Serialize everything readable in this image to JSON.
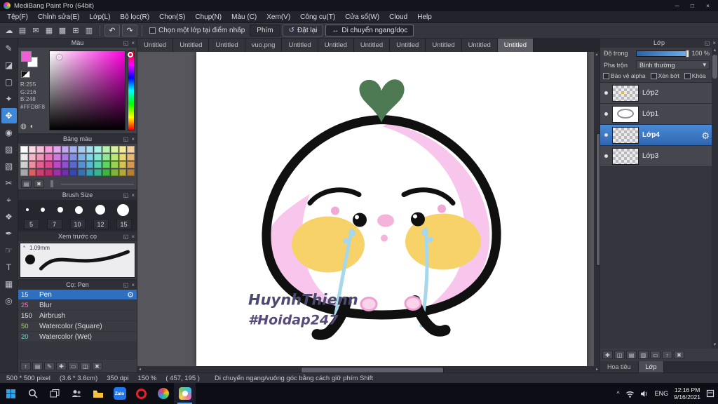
{
  "colors": {
    "accent": "#3f87d8",
    "selection": "#2f6fbf",
    "current_color": "#FFD8F8"
  },
  "window": {
    "title": "MediBang Paint Pro (64bit)",
    "minimize": "─",
    "maximize": "□",
    "close": "×"
  },
  "menubar": {
    "items": [
      "Tệp(F)",
      "Chỉnh sửa(E)",
      "Lớp(L)",
      "Bộ lọc(R)",
      "Chọn(S)",
      "Chụp(N)",
      "Màu (C)",
      "Xem(V)",
      "Công cụ(T)",
      "Cửa sổ(W)",
      "Cloud",
      "Help"
    ]
  },
  "toolbar": {
    "icons": [
      {
        "name": "cloud-icon",
        "glyph": "☁"
      },
      {
        "name": "save-icon",
        "glyph": "▤"
      },
      {
        "name": "mail-icon",
        "glyph": "✉"
      },
      {
        "name": "page-icon",
        "glyph": "▦"
      },
      {
        "name": "grid-icon",
        "glyph": "▩"
      },
      {
        "name": "snap-grid-icon",
        "glyph": "⊞"
      },
      {
        "name": "material-icon",
        "glyph": "▥"
      }
    ],
    "undo": "↶",
    "redo": "↷",
    "checkbox_label": "Chọn một lớp tại điểm nhấp",
    "key_label": "Phím",
    "reset_label": "Đặt lại",
    "move_label": "Di chuyển ngang/dọc"
  },
  "toolstrip": {
    "tools": [
      {
        "name": "pen-tool",
        "glyph": "✎",
        "selected": false
      },
      {
        "name": "eraser-tool",
        "glyph": "◪",
        "selected": false
      },
      {
        "name": "marquee-tool",
        "glyph": "▢",
        "selected": false
      },
      {
        "name": "magic-wand-tool",
        "glyph": "✦",
        "selected": false
      },
      {
        "name": "move-tool",
        "glyph": "✥",
        "selected": true
      },
      {
        "name": "bucket-tool",
        "glyph": "◉",
        "selected": false
      },
      {
        "name": "gradient-tool",
        "glyph": "▨",
        "selected": false
      },
      {
        "name": "fill-rect-tool",
        "glyph": "▧",
        "selected": false
      },
      {
        "name": "scissors-tool",
        "glyph": "✂",
        "selected": false
      },
      {
        "name": "lasso-tool",
        "glyph": "⌖",
        "selected": false
      },
      {
        "name": "divide-tool",
        "glyph": "❖",
        "selected": false
      },
      {
        "name": "eyedropper-tool",
        "glyph": "✒",
        "selected": false
      },
      {
        "name": "hand-tool",
        "glyph": "☞",
        "selected": false
      },
      {
        "name": "text-tool",
        "glyph": "T",
        "selected": false
      },
      {
        "name": "frame-tool",
        "glyph": "▦",
        "selected": false
      },
      {
        "name": "zoom-tool",
        "glyph": "◎",
        "selected": false
      }
    ]
  },
  "color_panel": {
    "title": "Màu",
    "r_label": "R:255",
    "g_label": "G:216",
    "b_label": "B:248",
    "hex_label": "#FFD8F8"
  },
  "palette_panel": {
    "title": "Bảng màu",
    "colors": [
      "#ffffff",
      "#fadbe4",
      "#f7bfdc",
      "#f3a0d8",
      "#e3a6ec",
      "#c3a8f0",
      "#a8b0f0",
      "#a8ccf0",
      "#a8e0f0",
      "#a8f0e4",
      "#b8f0b0",
      "#d8f0a4",
      "#f0ec9c",
      "#f0d0a0",
      "#ececec",
      "#f4b8c8",
      "#f098b8",
      "#ec74b8",
      "#d078dc",
      "#a878e4",
      "#8090e4",
      "#80b4e8",
      "#80d4e8",
      "#80e8d0",
      "#90e890",
      "#bce878",
      "#e8dc70",
      "#e8b878",
      "#d0d0d0",
      "#ec8f9f",
      "#e4608f",
      "#dc4890",
      "#bc48c8",
      "#8c50d0",
      "#5868d0",
      "#5890d4",
      "#58b8d4",
      "#58d4ac",
      "#60d460",
      "#98d450",
      "#d4c450",
      "#d49850",
      "#a8a8a8",
      "#d86060",
      "#cc4070",
      "#c03070",
      "#a030a8",
      "#7030b0",
      "#3848b0",
      "#3870b4",
      "#38a0b4",
      "#38b490",
      "#40b440",
      "#80b438",
      "#b4a838",
      "#b48038"
    ]
  },
  "brush_size_panel": {
    "title": "Brush Size",
    "dot_sizes": [
      4,
      6,
      8,
      11,
      14,
      17
    ],
    "labels": [
      "5",
      "7",
      "10",
      "12",
      "15"
    ]
  },
  "preview_panel": {
    "title": "Xem trước cọ",
    "size_label": "1.09mm"
  },
  "brush_panel": {
    "title": "Cọ: Pen",
    "brushes": [
      {
        "size": "15",
        "name": "Pen",
        "color": "#7ec8f0",
        "selected": true
      },
      {
        "size": "25",
        "name": "Blur",
        "color": "#f070c0",
        "selected": false
      },
      {
        "size": "150",
        "name": "Airbrush",
        "color": "#e8e8ee",
        "selected": false
      },
      {
        "size": "50",
        "name": "Watercolor (Square)",
        "color": "#a0d870",
        "selected": false
      },
      {
        "size": "20",
        "name": "Watercolor (Wet)",
        "color": "#70d8d0",
        "selected": false
      }
    ],
    "footer_icons": [
      {
        "name": "upload-brush-icon",
        "glyph": "↑"
      },
      {
        "name": "new-brush-icon",
        "glyph": "▤"
      },
      {
        "name": "edit-brush-icon",
        "glyph": "✎"
      },
      {
        "name": "add-brush-icon",
        "glyph": "✚"
      },
      {
        "name": "brush-folder-icon",
        "glyph": "▭"
      },
      {
        "name": "duplicate-brush-icon",
        "glyph": "◫"
      },
      {
        "name": "delete-brush-icon",
        "glyph": "✖"
      }
    ]
  },
  "canvas": {
    "tabs": [
      "Untitled",
      "Untitled",
      "Untitled",
      "vuo.png",
      "Untitled",
      "Untitled",
      "Untitled",
      "Untitled",
      "Untitled",
      "Untitled",
      "Untitled"
    ],
    "active_tab": 10,
    "signature_line1": "HuynhThienn",
    "signature_line2": "#Hoidap247"
  },
  "layers_panel": {
    "title": "Lớp",
    "opacity_label": "Độ trong",
    "opacity_value": "100 %",
    "blend_label": "Pha trộn",
    "blend_value": "Bình thường",
    "checkboxes": [
      "Bảo vệ alpha",
      "Xén bớt",
      "Khóa"
    ],
    "layers": [
      {
        "name": "Lớp2",
        "thumb": "sparkle",
        "selected": false
      },
      {
        "name": "Lớp1",
        "thumb": "sketch",
        "selected": false
      },
      {
        "name": "Lớp4",
        "thumb": "checker",
        "selected": true
      },
      {
        "name": "Lớp3",
        "thumb": "checker",
        "selected": false
      }
    ],
    "footer_icons": [
      {
        "name": "add-layer-icon",
        "glyph": "✚"
      },
      {
        "name": "duplicate-layer-icon",
        "glyph": "◫"
      },
      {
        "name": "layer-folder-icon",
        "glyph": "▤"
      },
      {
        "name": "merge-layer-icon",
        "glyph": "▥"
      },
      {
        "name": "clear-layer-icon",
        "glyph": "▭"
      },
      {
        "name": "layer-up-icon",
        "glyph": "↑"
      },
      {
        "name": "delete-layer-icon",
        "glyph": "✖"
      }
    ],
    "bottom_tabs": [
      "Hoa tiêu",
      "Lớp"
    ]
  },
  "statusbar": {
    "segments": [
      "500 * 500 pixel",
      "(3.6 * 3.6cm)",
      "350 dpi",
      "150 %",
      "( 457, 195 )",
      "Di chuyển ngang/vuông góc bằng cách giữ phím Shift"
    ]
  },
  "taskbar": {
    "zalo_label": "Zalo",
    "language": "ENG",
    "time": "12:16 PM",
    "date": "9/16/2021"
  }
}
